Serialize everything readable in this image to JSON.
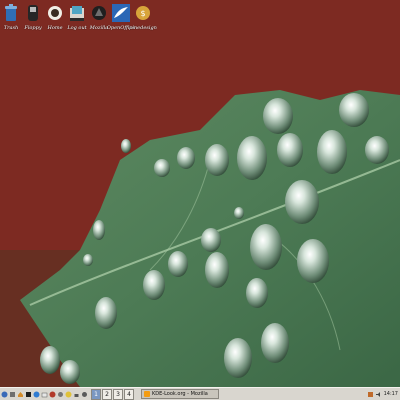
{
  "desktop": {
    "icons": [
      {
        "name": "trash-icon",
        "label": "Trash"
      },
      {
        "name": "floppy-icon",
        "label": "Floppy"
      },
      {
        "name": "home-icon",
        "label": "Home"
      },
      {
        "name": "logout-icon",
        "label": "Log out"
      },
      {
        "name": "mozilla-icon",
        "label": "Mozilla"
      },
      {
        "name": "openoffice-icon",
        "label": "OpenOffice"
      },
      {
        "name": "pinedesign-icon",
        "label": "pinedesign"
      }
    ]
  },
  "taskbar": {
    "pager": [
      "1",
      "2",
      "3",
      "4"
    ],
    "active_desktop": "1",
    "task_title": "KDE-Look.org - Mozilla",
    "clock": "14:17"
  },
  "colors": {
    "wallpaper_background": "#7e2922",
    "leaf": "#4f7d55",
    "taskbar": "#d9d6cf"
  }
}
